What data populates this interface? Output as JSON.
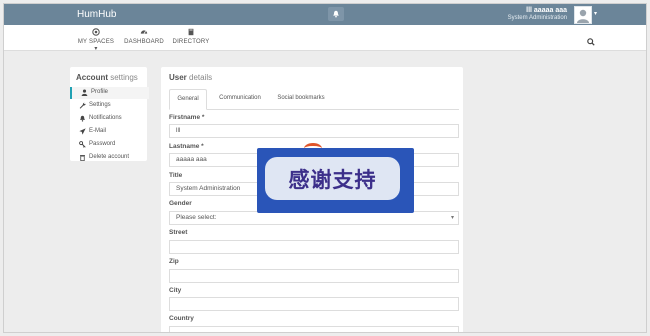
{
  "topbar": {
    "brand": "HumHub",
    "user_name": "lll aaaaa aaa",
    "user_role": "System Administration",
    "icons": {
      "notifications": "bell-icon",
      "avatar": "avatar",
      "caret": "chevron-down-icon"
    }
  },
  "nav": {
    "items": [
      {
        "label": "MY SPACES ▾",
        "icon": "circle-dot-icon"
      },
      {
        "label": "DASHBOARD",
        "icon": "dashboard-icon"
      },
      {
        "label": "DIRECTORY",
        "icon": "book-icon"
      }
    ],
    "search_icon": "search-icon"
  },
  "sidebar": {
    "title_bold": "Account",
    "title_rest": " settings",
    "items": [
      {
        "label": "Profile",
        "icon": "user-icon",
        "active": true
      },
      {
        "label": "Settings",
        "icon": "wrench-icon"
      },
      {
        "label": "Notifications",
        "icon": "bell-icon"
      },
      {
        "label": "E-Mail",
        "icon": "paper-plane-icon"
      },
      {
        "label": "Password",
        "icon": "key-icon"
      },
      {
        "label": "Delete account",
        "icon": "trash-icon"
      }
    ]
  },
  "main": {
    "title_bold": "User",
    "title_rest": " details",
    "tabs": [
      {
        "label": "General",
        "active": true
      },
      {
        "label": "Communication"
      },
      {
        "label": "Social bookmarks"
      }
    ],
    "fields": {
      "firstname": {
        "label": "Firstname *",
        "value": "lll"
      },
      "lastname": {
        "label": "Lastname *",
        "value": "aaaaa aaa"
      },
      "title": {
        "label": "Title",
        "value": "System Administration"
      },
      "gender": {
        "label": "Gender",
        "value": "Please select:"
      },
      "street": {
        "label": "Street",
        "value": ""
      },
      "zip": {
        "label": "Zip",
        "value": ""
      },
      "city": {
        "label": "City",
        "value": ""
      },
      "country": {
        "label": "Country",
        "value": ""
      }
    }
  },
  "overlay": {
    "text": "感谢支持"
  },
  "colors": {
    "topbar": "#6b8599",
    "accent": "#21a1b3",
    "overlay_bg": "#2a55b8",
    "overlay_text": "#3c2f8a"
  }
}
